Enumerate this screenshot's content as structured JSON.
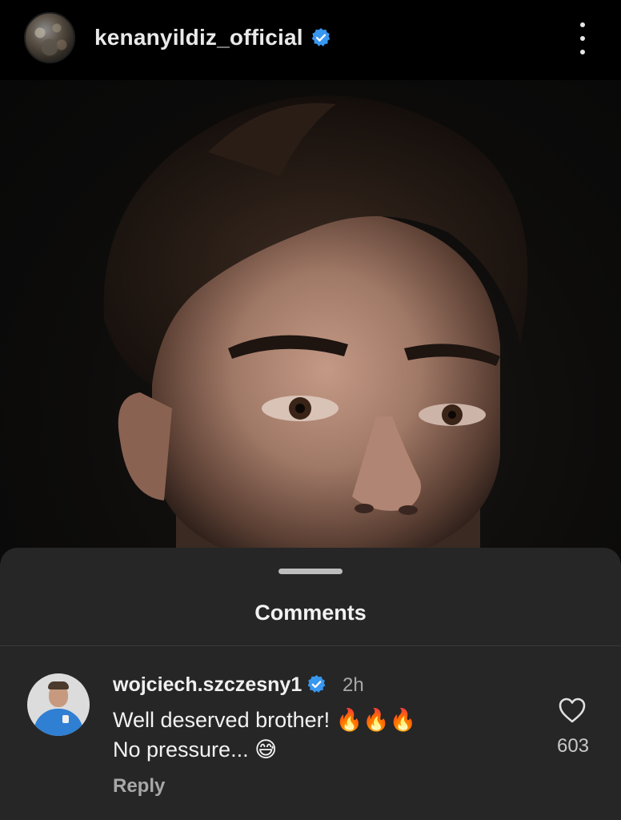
{
  "header": {
    "username": "kenanyildiz_official",
    "verified": true,
    "menu_icon": "more-vertical-icon"
  },
  "post": {
    "image": "portrait-photo"
  },
  "comments_sheet": {
    "title": "Comments",
    "comments": [
      {
        "username": "wojciech.szczesny1",
        "verified": true,
        "time": "2h",
        "text": "Well deserved brother! 🔥🔥🔥\nNo pressure... 😅",
        "reply_label": "Reply",
        "likes": "603"
      }
    ]
  },
  "colors": {
    "verified_blue": "#3897f0",
    "sheet_bg": "#262626",
    "header_bg": "#000000"
  }
}
